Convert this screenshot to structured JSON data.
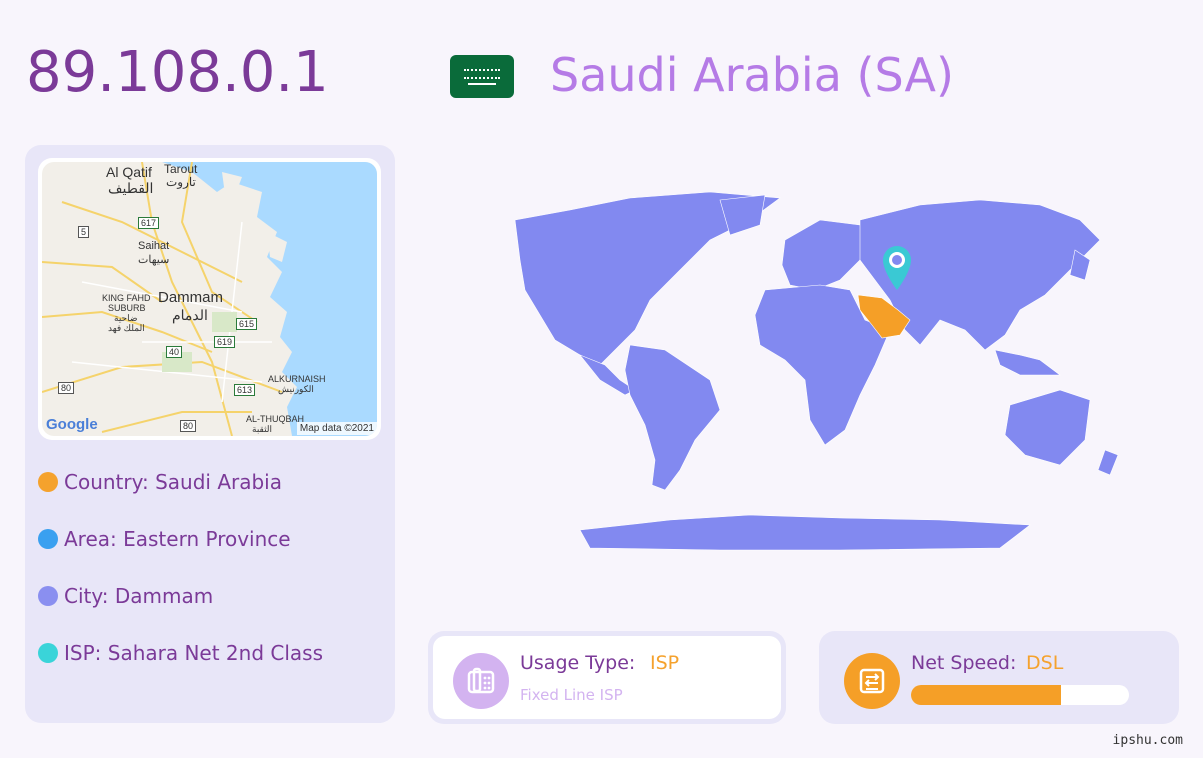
{
  "header": {
    "ip": "89.108.0.1",
    "country_title": "Saudi Arabia (SA)"
  },
  "map": {
    "labels": {
      "qatif": "Al Qatif",
      "qatif_ar": "القطيف",
      "tarout": "Tarout",
      "tarout_ar": "تاروت",
      "saihat": "Saihat",
      "saihat_ar": "سيهات",
      "king_fahd": "KING FAHD",
      "suburb": "SUBURB",
      "king_fahd_ar": "ضاحية",
      "king_fahd_ar2": "الملك فهد",
      "dammam": "Dammam",
      "dammam_ar": "الدمام",
      "alkurnaish": "ALKURNAISH",
      "alkurnaish_ar": "الكورنيش",
      "althuqbah": "AL-THUQBAH",
      "althuqbah_ar": "الثقبة",
      "road_617": "617",
      "road_5": "5",
      "road_615": "615",
      "road_619": "619",
      "road_40": "40",
      "road_80a": "80",
      "road_613": "613",
      "road_80b": "80"
    },
    "google": "Google",
    "attribution": "Map data ©2021"
  },
  "info": {
    "country": "Country: Saudi Arabia",
    "area": "Area: Eastern Province",
    "city": "City: Dammam",
    "isp": "ISP: Sahara Net 2nd Class"
  },
  "usage": {
    "label": "Usage Type:",
    "value": "ISP",
    "sub": "Fixed Line ISP"
  },
  "speed": {
    "label": "Net Speed:",
    "value": "DSL",
    "fill_fraction": 0.69
  },
  "footer": "ipshu.com",
  "colors": {
    "ip": "#7b3a98",
    "title": "#b57be6",
    "country_dot": "#f5a22d",
    "area_dot": "#3aa0f0",
    "city_dot": "#8a8ff0",
    "isp_dot": "#3ad4d9",
    "world": "#8289f0",
    "highlight": "#f59f27",
    "pin": "#3ac9d4"
  }
}
